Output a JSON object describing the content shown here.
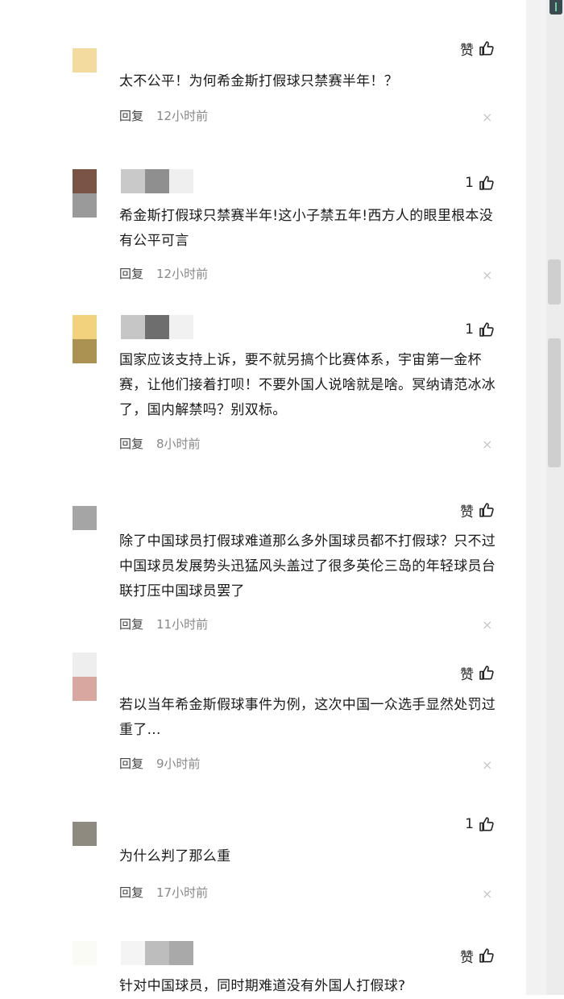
{
  "colors": {
    "background": "#ffffff",
    "text": "#1a1a1a",
    "meta_text": "#888888",
    "close_icon": "#c7c7c7",
    "right_strip": "#f2f2f2",
    "scroll_track": "#ececec",
    "scroll_thumb": "#cfcfcf"
  },
  "icons": {
    "like": "thumbs-up-icon",
    "dismiss": "close-icon"
  },
  "comments": [
    {
      "like": "赞",
      "text": "太不公平！为何希金斯打假球只禁赛半年！？",
      "reply": "回复",
      "time": "12小时前",
      "close": "×",
      "avatar_colors": [
        "#f3dba0"
      ],
      "name_colors": []
    },
    {
      "like": "1",
      "text": "希金斯打假球只禁赛半年!这小子禁五年!西方人的眼里根本没有公平可言",
      "reply": "回复",
      "time": "12小时前",
      "close": "×",
      "avatar_colors": [
        "#7a5546",
        "#9a9a9a"
      ],
      "name_colors": [
        "#c9c9c9",
        "#8f8f8f",
        "#efefef"
      ]
    },
    {
      "like": "1",
      "text": "国家应该支持上诉，要不就另搞个比赛体系，宇宙第一金杯赛，让他们接着打呗！不要外国人说啥就是啥。冥纳请范冰冰了，国内解禁吗？别双标。",
      "reply": "回复",
      "time": "8小时前",
      "close": "×",
      "avatar_colors": [
        "#f2d27c",
        "#ab9152"
      ],
      "name_colors": [
        "#c6c6c6",
        "#6e6e6e",
        "#f1f1f1"
      ]
    },
    {
      "like": "赞",
      "text": "除了中国球员打假球难道那么多外国球员都不打假球？只不过中国球员发展势头迅猛风头盖过了很多英伦三岛的年轻球员台联打压中国球员罢了",
      "reply": "回复",
      "time": "11小时前",
      "close": "×",
      "avatar_colors": [
        "#a5a5a5"
      ],
      "name_colors": []
    },
    {
      "like": "赞",
      "text": "若以当年希金斯假球事件为例，这次中国一众选手显然处罚过重了...",
      "reply": "回复",
      "time": "9小时前",
      "close": "×",
      "avatar_colors": [
        "#eeeeee",
        "#d8a7a0"
      ],
      "name_colors": []
    },
    {
      "like": "1",
      "text": "为什么判了那么重",
      "reply": "回复",
      "time": "17小时前",
      "close": "×",
      "avatar_colors": [
        "#8e8a80"
      ],
      "name_colors": []
    },
    {
      "like": "赞",
      "text": "针对中国球员，同时期难道没有外国人打假球?",
      "reply": "",
      "time": "",
      "close": "",
      "avatar_colors": [
        "#fbfbf6"
      ],
      "name_colors": [
        "#f4f4f4",
        "#bdbdbd",
        "#a9a9a9"
      ]
    }
  ]
}
